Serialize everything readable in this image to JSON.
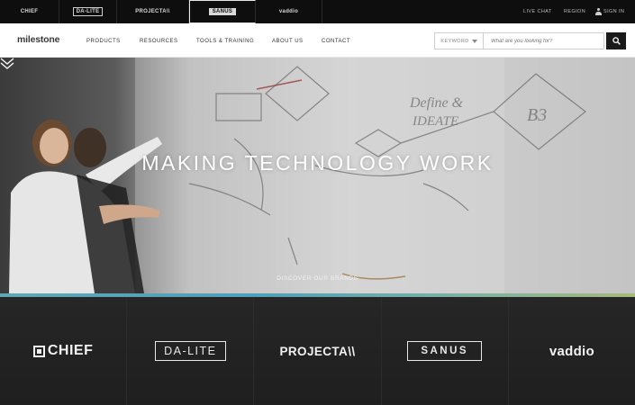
{
  "brand_bar": {
    "items": [
      "CHIEF",
      "DA-LITE",
      "PROJECTA\\\\",
      "SANUS",
      "vaddio"
    ],
    "utility": [
      "LIVE CHAT",
      "REGION"
    ],
    "signin_label": "SIGN IN"
  },
  "nav": {
    "logo": "milestone",
    "items": [
      "PRODUCTS",
      "RESOURCES",
      "TOOLS & TRAINING",
      "ABOUT US",
      "CONTACT"
    ],
    "keyword_label": "KEYWORD",
    "search_placeholder": "What are you looking for?"
  },
  "hero": {
    "title": "MAKING TECHNOLOGY WORK",
    "discover_label": "DISCOVER OUR BRANDS",
    "whiteboard_text": [
      "Define &",
      "IDEATE",
      "B3"
    ]
  },
  "brand_strip": {
    "chief": "CHIEF",
    "dalite": "DA-LITE",
    "projecta": "PROJECTA\\\\",
    "sanus": "SANUS",
    "vaddio": "vaddio"
  },
  "colors": {
    "brand_bar_bg": "#0e0e0e",
    "strip_bg": "#232323",
    "accent_stripe": "#5fa8b6"
  },
  "icons": [
    "person-icon",
    "search-icon",
    "chevron-down-icon",
    "caret-down-icon"
  ]
}
